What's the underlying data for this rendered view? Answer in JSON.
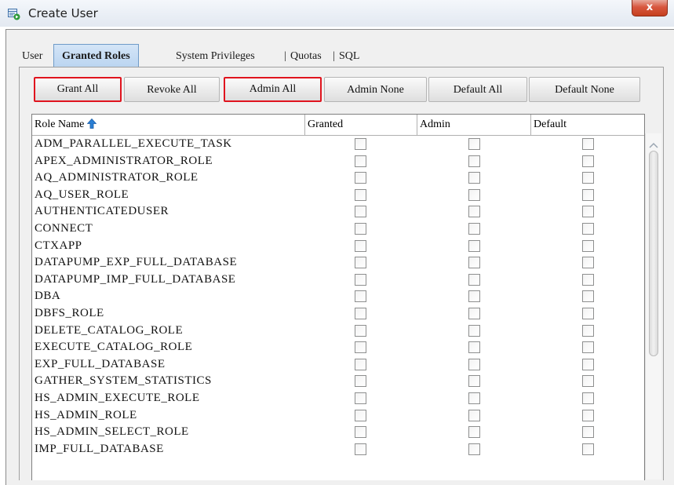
{
  "window": {
    "title": "Create User",
    "close_label": "x"
  },
  "tabs": [
    {
      "label": "User"
    },
    {
      "label": "Granted Roles",
      "active": true
    },
    {
      "label": "System Privileges"
    },
    {
      "label": "Quotas"
    },
    {
      "label": "SQL"
    }
  ],
  "tab_separator": "|",
  "buttons": {
    "grant_all": "Grant All",
    "revoke_all": "Revoke All",
    "admin_all": "Admin All",
    "admin_none": "Admin None",
    "default_all": "Default All",
    "default_none": "Default None"
  },
  "table": {
    "columns": {
      "role_name": "Role Name",
      "granted": "Granted",
      "admin": "Admin",
      "default": "Default"
    },
    "sort_icon": "sort-ascending-icon",
    "rows": [
      {
        "role": "ADM_PARALLEL_EXECUTE_TASK",
        "granted": false,
        "admin": false,
        "default": false
      },
      {
        "role": "APEX_ADMINISTRATOR_ROLE",
        "granted": false,
        "admin": false,
        "default": false
      },
      {
        "role": "AQ_ADMINISTRATOR_ROLE",
        "granted": false,
        "admin": false,
        "default": false
      },
      {
        "role": "AQ_USER_ROLE",
        "granted": false,
        "admin": false,
        "default": false
      },
      {
        "role": "AUTHENTICATEDUSER",
        "granted": false,
        "admin": false,
        "default": false
      },
      {
        "role": "CONNECT",
        "granted": false,
        "admin": false,
        "default": false
      },
      {
        "role": "CTXAPP",
        "granted": false,
        "admin": false,
        "default": false
      },
      {
        "role": "DATAPUMP_EXP_FULL_DATABASE",
        "granted": false,
        "admin": false,
        "default": false
      },
      {
        "role": "DATAPUMP_IMP_FULL_DATABASE",
        "granted": false,
        "admin": false,
        "default": false
      },
      {
        "role": "DBA",
        "granted": false,
        "admin": false,
        "default": false
      },
      {
        "role": "DBFS_ROLE",
        "granted": false,
        "admin": false,
        "default": false
      },
      {
        "role": "DELETE_CATALOG_ROLE",
        "granted": false,
        "admin": false,
        "default": false
      },
      {
        "role": "EXECUTE_CATALOG_ROLE",
        "granted": false,
        "admin": false,
        "default": false
      },
      {
        "role": "EXP_FULL_DATABASE",
        "granted": false,
        "admin": false,
        "default": false
      },
      {
        "role": "GATHER_SYSTEM_STATISTICS",
        "granted": false,
        "admin": false,
        "default": false
      },
      {
        "role": "HS_ADMIN_EXECUTE_ROLE",
        "granted": false,
        "admin": false,
        "default": false
      },
      {
        "role": "HS_ADMIN_ROLE",
        "granted": false,
        "admin": false,
        "default": false
      },
      {
        "role": "HS_ADMIN_SELECT_ROLE",
        "granted": false,
        "admin": false,
        "default": false
      },
      {
        "role": "IMP_FULL_DATABASE",
        "granted": false,
        "admin": false,
        "default": false
      }
    ]
  },
  "colors": {
    "highlight_border": "#e0141e",
    "active_tab": "#b9d4f0",
    "sort_icon": "#2a7fd4"
  }
}
